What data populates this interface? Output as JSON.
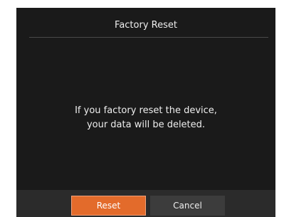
{
  "dialog": {
    "title": "Factory Reset",
    "message_line1": "If you factory reset the device,",
    "message_line2": "your data will be deleted.",
    "buttons": {
      "reset_label": "Reset",
      "cancel_label": "Cancel"
    }
  },
  "colors": {
    "dialog_background": "#1a1a1a",
    "footer_background": "#2b2b2b",
    "reset_button": "#e36b2b",
    "cancel_button": "#3c3c3c",
    "text": "#eeeeee"
  }
}
